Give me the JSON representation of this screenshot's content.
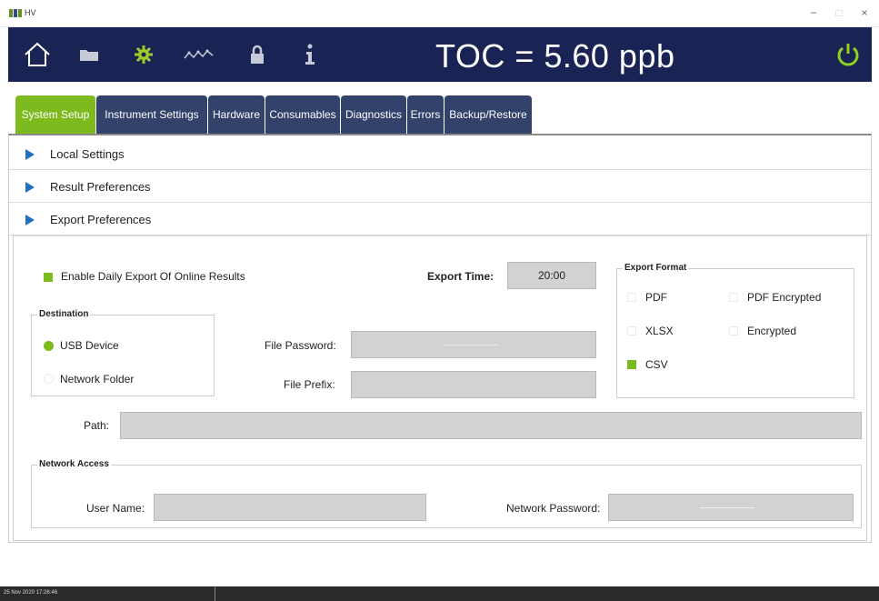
{
  "window": {
    "title": "HV",
    "minimize": "−",
    "close": "×"
  },
  "header": {
    "toc_readout": "TOC = 5.60 ppb",
    "icons": [
      "home-icon",
      "folder-icon",
      "gear-icon",
      "trend-icon",
      "lock-icon",
      "info-icon",
      "power-icon"
    ],
    "colors": {
      "bg": "#1a2454",
      "accent": "#7dba1e"
    }
  },
  "tabs": [
    {
      "label": "System Setup",
      "active": true
    },
    {
      "label": "Instrument Settings"
    },
    {
      "label": "Hardware"
    },
    {
      "label": "Consumables"
    },
    {
      "label": "Diagnostics"
    },
    {
      "label": "Errors"
    },
    {
      "label": "Backup/Restore"
    }
  ],
  "accordion": {
    "local_settings": "Local Settings",
    "result_preferences": "Result Preferences",
    "export_preferences": "Export Preferences"
  },
  "export": {
    "enable_daily": {
      "label": "Enable Daily Export Of Online Results",
      "checked": true
    },
    "export_time": {
      "label": "Export Time:",
      "value": "20:00"
    },
    "destination": {
      "legend": "Destination",
      "usb": {
        "label": "USB Device",
        "selected": true
      },
      "network": {
        "label": "Network Folder",
        "selected": false
      }
    },
    "file_password": {
      "label": "File Password:",
      "value": ""
    },
    "file_prefix": {
      "label": "File Prefix:",
      "value": ""
    },
    "format": {
      "legend": "Export Format",
      "pdf": {
        "label": "PDF",
        "checked": false
      },
      "pdf_encrypted": {
        "label": "PDF Encrypted",
        "checked": false
      },
      "xlsx": {
        "label": "XLSX",
        "checked": false
      },
      "encrypted": {
        "label": "Encrypted",
        "checked": false
      },
      "csv": {
        "label": "CSV",
        "checked": true
      }
    },
    "path": {
      "label": "Path:",
      "value": ""
    },
    "network_access": {
      "legend": "Network Access",
      "user_name": {
        "label": "User Name:",
        "value": ""
      },
      "network_password": {
        "label": "Network Password:",
        "value": ""
      }
    }
  },
  "taskbar": {
    "datetime": "25 Nov 2020  17:26:46"
  }
}
